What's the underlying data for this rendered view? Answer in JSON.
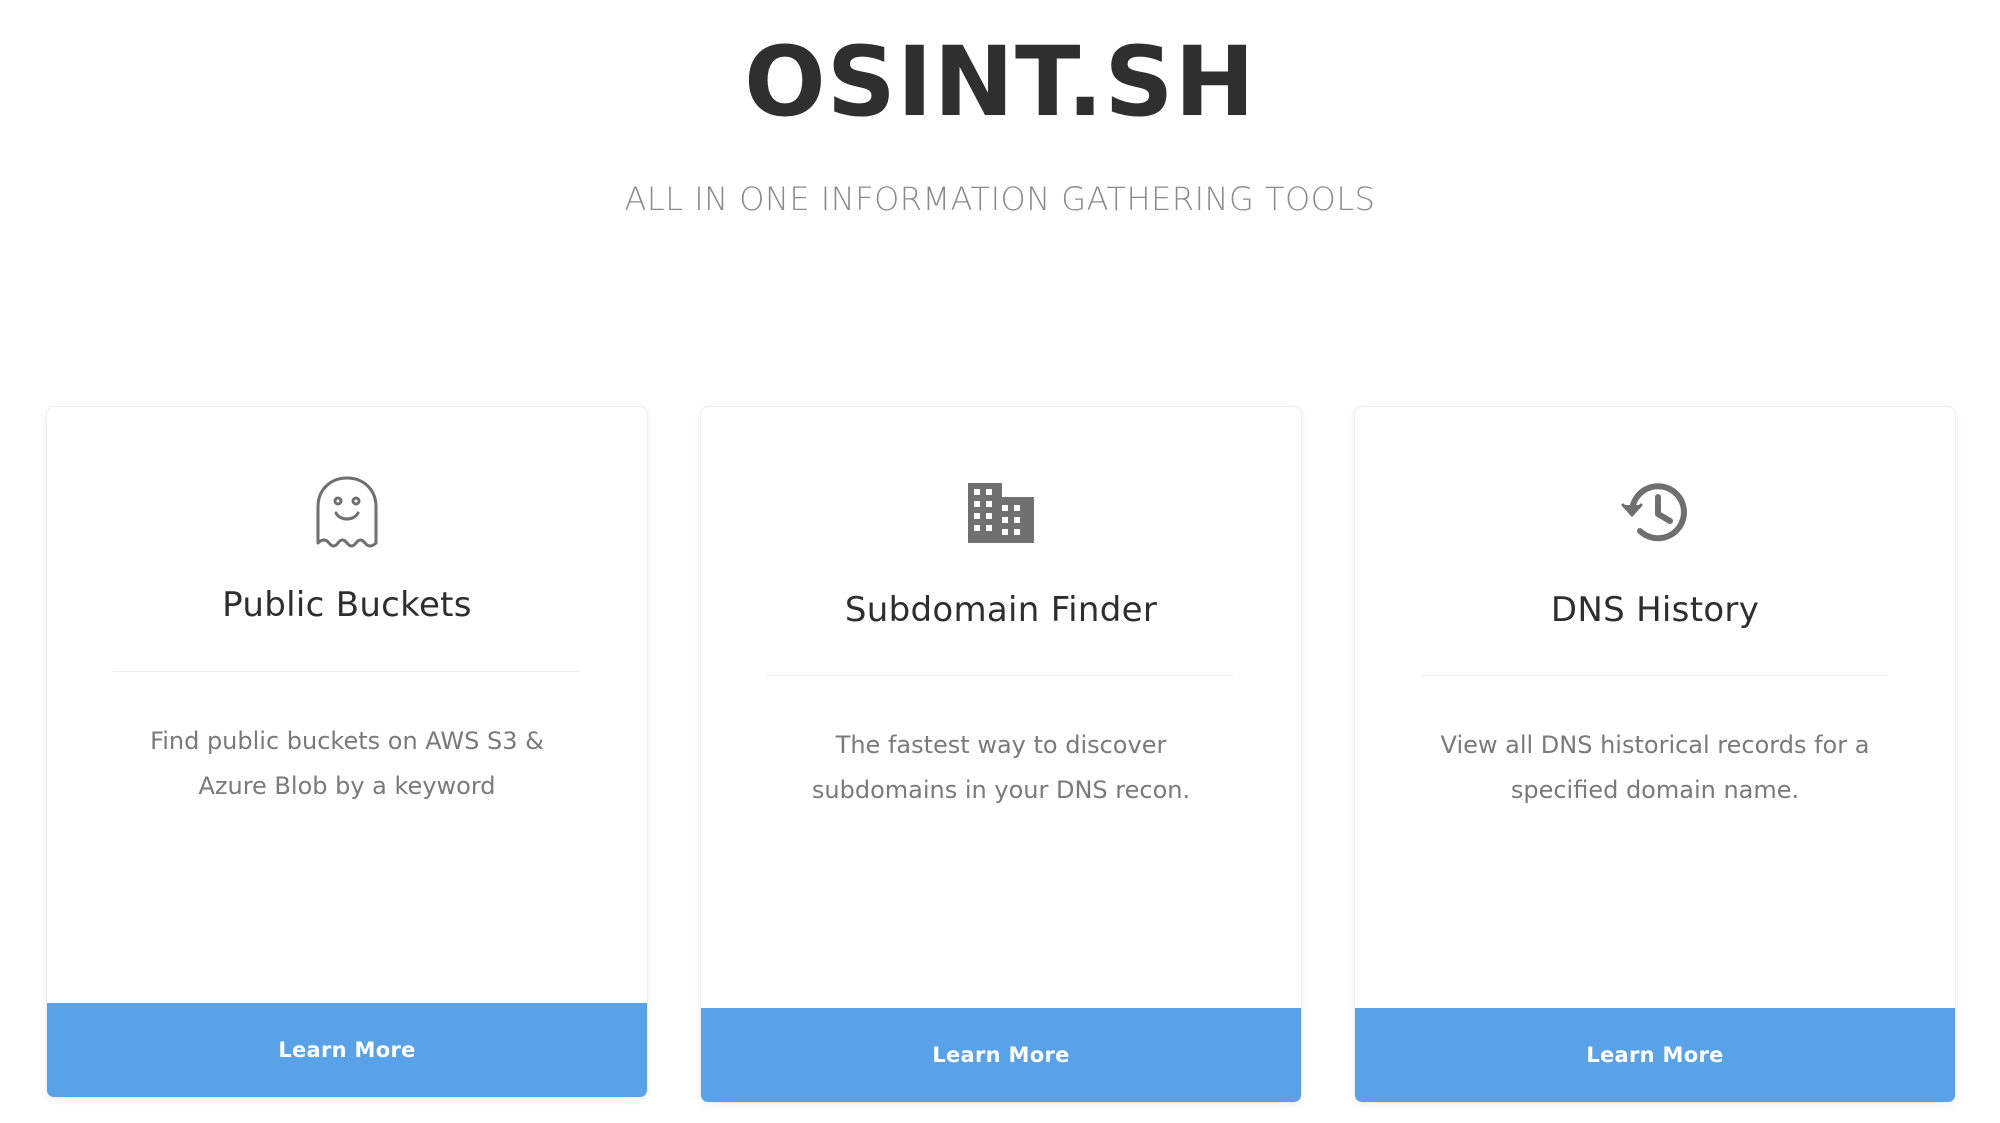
{
  "header": {
    "title": "OSINT.SH",
    "subtitle": "ALL IN ONE INFORMATION GATHERING TOOLS"
  },
  "cards": [
    {
      "icon": "ghost-icon",
      "title": "Public Buckets",
      "description": "Find public buckets on AWS S3 & Azure Blob by a keyword",
      "button_label": "Learn More"
    },
    {
      "icon": "building-icon",
      "title": "Subdomain Finder",
      "description": "The fastest way to discover subdomains in your DNS recon.",
      "button_label": "Learn More"
    },
    {
      "icon": "history-icon",
      "title": "DNS History",
      "description": "View all DNS historical records for a specified domain name.",
      "button_label": "Learn More"
    }
  ],
  "colors": {
    "button_background": "#5aa2e8",
    "icon_color": "#6f6f6f",
    "title_color": "#2f2f2f",
    "subtitle_color": "#8a8a8a"
  }
}
